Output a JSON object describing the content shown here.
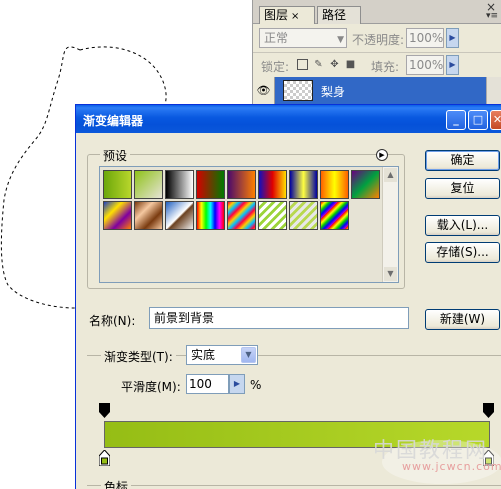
{
  "layers_panel": {
    "tabs": [
      {
        "label": "图层",
        "close": "×"
      },
      {
        "label": "路径"
      }
    ],
    "close_glyph": "×",
    "menu_glyph": "▾≡",
    "blend_mode": "正常",
    "opacity_label": "不透明度:",
    "opacity_value": "100%",
    "lock_label": "锁定:",
    "fill_label": "填充:",
    "fill_value": "100%",
    "layer_name": "梨身"
  },
  "dialog": {
    "title": "渐变编辑器",
    "presets_label": "预设",
    "buttons": {
      "ok": "确定",
      "reset": "复位",
      "load": "载入(L)...",
      "save": "存储(S)...",
      "new": "新建(W)"
    },
    "name_label": "名称(N):",
    "name_value": "前景到背景",
    "gradient_type_label": "渐变类型(T):",
    "gradient_type_value": "实底",
    "smoothness_label": "平滑度(M):",
    "smoothness_value": "100",
    "smoothness_unit": "%",
    "color_stops_label": "色标",
    "gradient": {
      "start": "#95bd15",
      "end": "#b7d82a"
    },
    "presets": [
      {
        "name": "green-solid",
        "css": "linear-gradient(90deg,#6ca70a,#b8d62c)"
      },
      {
        "name": "green-transparent",
        "css": "linear-gradient(135deg,#8fc21a,rgba(143,194,26,0))"
      },
      {
        "name": "black-white",
        "css": "linear-gradient(90deg,#000,#fff)"
      },
      {
        "name": "red-green",
        "css": "linear-gradient(90deg,#d40000,#007a00)"
      },
      {
        "name": "violet-orange",
        "css": "linear-gradient(90deg,#4b0a6b,#ff8000)"
      },
      {
        "name": "blue-red-yellow",
        "css": "linear-gradient(90deg,#1010c0,#e00000,#ffe000)"
      },
      {
        "name": "blue-yellow-blue",
        "css": "linear-gradient(90deg,#0000a0,#ffff40,#0000a0)"
      },
      {
        "name": "orange-yellow-orange",
        "css": "linear-gradient(90deg,#ff6000,#ffff00,#ff6000)"
      },
      {
        "name": "violet-green-orange",
        "css": "linear-gradient(135deg,#6a0080,#00a040,#ff8000)"
      },
      {
        "name": "yellow-violet-orange-blue",
        "css": "linear-gradient(135deg,#2040c0,#ffe000,#8000a0,#ff8000)"
      },
      {
        "name": "copper",
        "css": "linear-gradient(135deg,#7a3b10,#f5c8a0,#7a3b10,#f5c8a0)"
      },
      {
        "name": "chrome",
        "css": "linear-gradient(135deg,#2060c0,#ffffff 50%,#6a4020 55%,#f0f0f0)"
      },
      {
        "name": "spectrum",
        "css": "linear-gradient(90deg,#f00,#ff0,#0f0,#0ff,#00f,#f0f,#f00)"
      },
      {
        "name": "transparent-rainbow",
        "css": "repeating-linear-gradient(135deg,#ff0040,#ffcc00 4px,#00c0ff 8px,#ff0040 12px)"
      },
      {
        "name": "transparent-stripes",
        "css": "repeating-linear-gradient(135deg,#fff,#fff 3px,#9cd43a 3px,#9cd43a 6px)"
      },
      {
        "name": "neutral-density",
        "css": "repeating-linear-gradient(135deg,#e8e8e8,#e8e8e8 3px,#b8d850 3px,#b8d850 6px)"
      },
      {
        "name": "rainbow-stripes",
        "css": "repeating-linear-gradient(135deg,#f00,#ff0 3px,#0c0 6px,#00f 9px,#c0c 12px)"
      }
    ]
  },
  "watermark": {
    "text": "中国教程网",
    "url": "www.jcwcn.com"
  }
}
